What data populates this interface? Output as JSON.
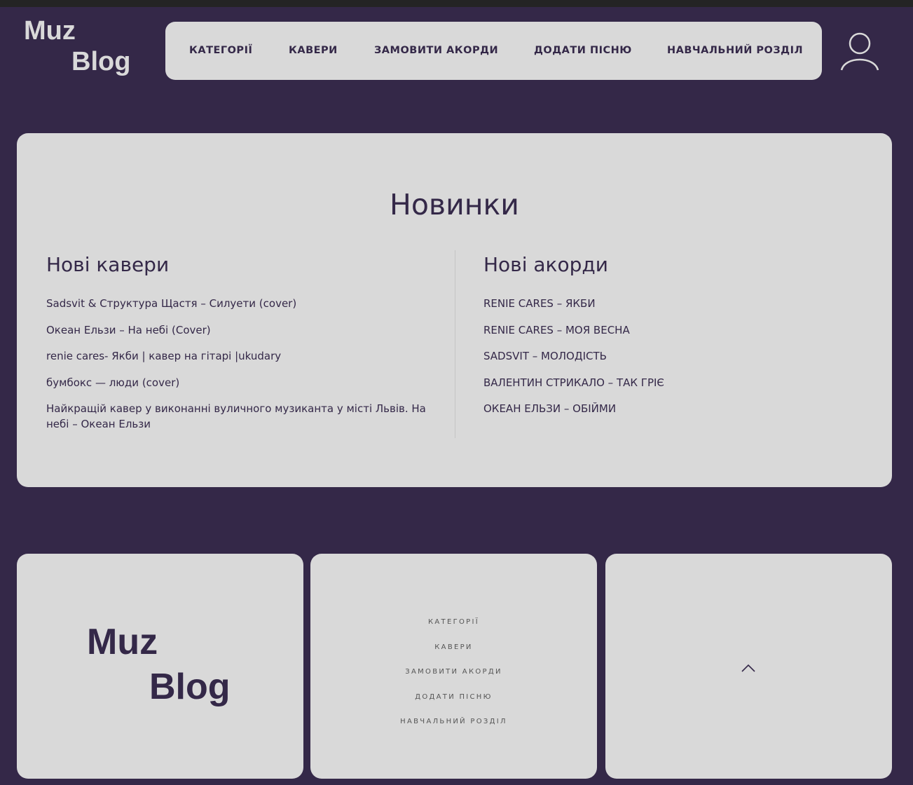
{
  "colors": {
    "background": "#342848",
    "card": "#d9d9d9",
    "text_dark": "#342848",
    "text_muted": "#555555"
  },
  "header": {
    "logo_line1": "Muz",
    "logo_line2": "Blog",
    "nav": [
      "КАТЕГОРІЇ",
      "КАВЕРИ",
      "ЗАМОВИТИ АКОРДИ",
      "ДОДАТИ ПІСНЮ",
      "НАВЧАЛЬНИЙ РОЗДІЛ"
    ],
    "user_icon": "user-icon"
  },
  "news": {
    "title": "Новинки",
    "covers": {
      "title": "Нові кавери",
      "items": [
        "Sadsvit & Структура Щастя – Силуети (cover)",
        "Океан Ельзи – На небі (Cover)",
        "renie cares- Якби | кавер на гітарі |ukudary",
        "бумбокс — люди (cover)",
        "Найкращій кавер у виконанні вуличного музиканта у місті Львів. На небі – Океан Ельзи"
      ]
    },
    "chords": {
      "title": "Нові акорди",
      "items": [
        "RENIE CARES – ЯКБИ",
        "RENIE CARES – МОЯ ВЕСНА",
        "SADSVIT – МОЛОДІСТЬ",
        "ВАЛЕНТИН СТРИКАЛО – ТАК ГРІЄ",
        "ОКЕАН ЕЛЬЗИ – ОБІЙМИ"
      ]
    }
  },
  "footer": {
    "logo_line1": "Muz",
    "logo_line2": "Blog",
    "nav": [
      "КАТЕГОРІЇ",
      "КАВЕРИ",
      "ЗАМОВИТИ АКОРДИ",
      "ДОДАТИ ПІСНЮ",
      "НАВЧАЛЬНИЙ РОЗДІЛ"
    ],
    "up_icon": "chevron-up-icon"
  }
}
